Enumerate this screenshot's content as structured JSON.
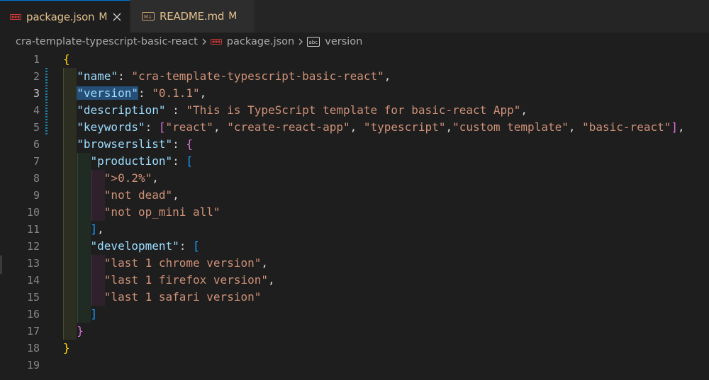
{
  "tabs": [
    {
      "label": "package.json",
      "status": "M",
      "active": true,
      "icon": "json-file-icon"
    },
    {
      "label": "README.md",
      "status": "M",
      "active": false,
      "icon": "markdown-file-icon"
    }
  ],
  "breadcrumb": {
    "folder": "cra-template-typescript-basic-react",
    "file": "package.json",
    "symbol": "version"
  },
  "editor": {
    "line_numbers": [
      "1",
      "2",
      "3",
      "4",
      "5",
      "6",
      "7",
      "8",
      "9",
      "10",
      "11",
      "12",
      "13",
      "14",
      "15",
      "16",
      "17",
      "18",
      "19"
    ],
    "active_line": "3",
    "tokens": {
      "l1_brace": "{",
      "l2_key": "\"name\"",
      "l2_colon": ": ",
      "l2_val": "\"cra-template-typescript-basic-react\"",
      "l2_comma": ",",
      "l3_key": "\"version\"",
      "l3_colon": ": ",
      "l3_val": "\"0.1.1\"",
      "l3_comma": ",",
      "l4_key": "\"description\"",
      "l4_colon": " : ",
      "l4_val": "\"This is TypeScript template for basic-react App\"",
      "l4_comma": ",",
      "l5_key": "\"keywords\"",
      "l5_colon": ": ",
      "l5_open": "[",
      "l5_v1": "\"react\"",
      "l5_c1": ", ",
      "l5_v2": "\"create-react-app\"",
      "l5_c2": ", ",
      "l5_v3": "\"typescript\"",
      "l5_c3": ",",
      "l5_v4": "\"custom template\"",
      "l5_c4": ", ",
      "l5_v5": "\"basic-react\"",
      "l5_close": "]",
      "l5_comma": ",",
      "l6_key": "\"browserslist\"",
      "l6_colon": ": ",
      "l6_open": "{",
      "l7_key": "\"production\"",
      "l7_colon": ": ",
      "l7_open": "[",
      "l8_val": "\">0.2%\"",
      "l8_comma": ",",
      "l9_val": "\"not dead\"",
      "l9_comma": ",",
      "l10_val": "\"not op_mini all\"",
      "l11_close": "]",
      "l11_comma": ",",
      "l12_key": "\"development\"",
      "l12_colon": ": ",
      "l12_open": "[",
      "l13_val": "\"last 1 chrome version\"",
      "l13_comma": ",",
      "l14_val": "\"last 1 firefox version\"",
      "l14_comma": ",",
      "l15_val": "\"last 1 safari version\"",
      "l16_close": "]",
      "l17_close": "}",
      "l18_close": "}"
    }
  },
  "colors": {
    "key": "#9cdcfe",
    "string": "#ce9178",
    "bracket_level1": "#ffd700",
    "bracket_level2": "#da70d6",
    "bracket_level3": "#179fff",
    "modified": "#e2c08d",
    "selection": "#264f78"
  }
}
